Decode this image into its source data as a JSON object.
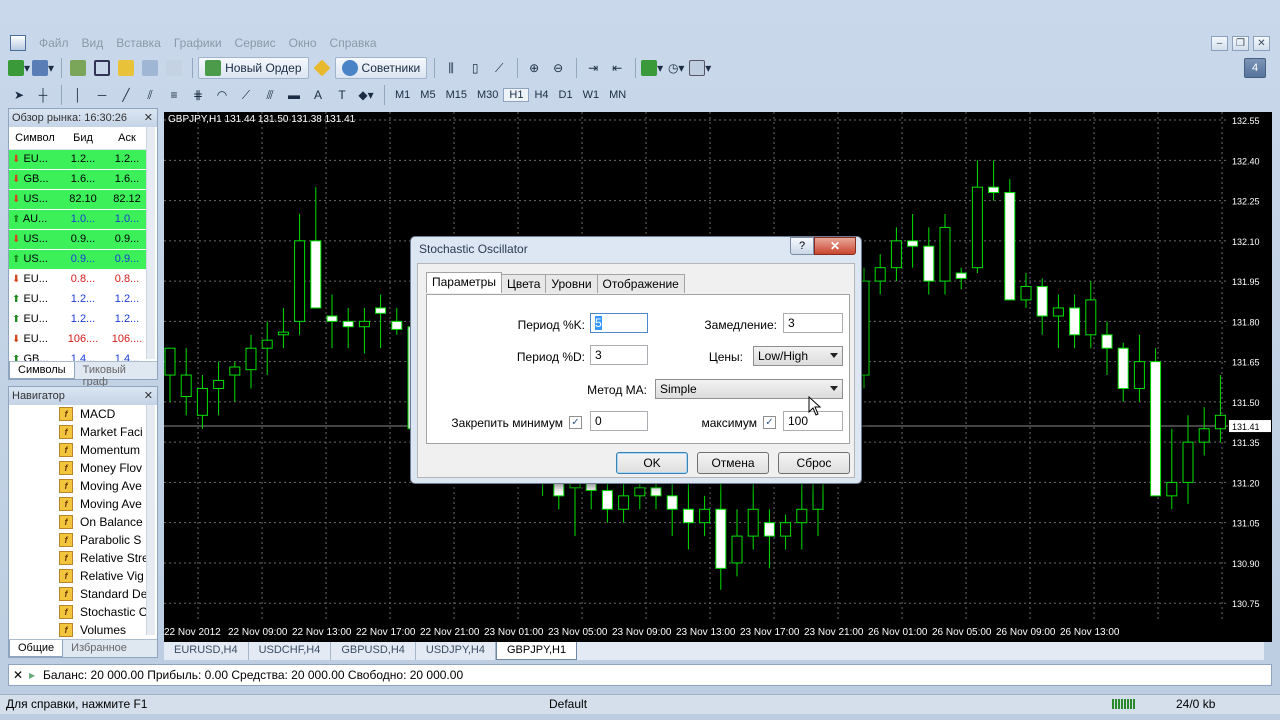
{
  "menu": [
    "Файл",
    "Вид",
    "Вставка",
    "Графики",
    "Сервис",
    "Окно",
    "Справка"
  ],
  "toolbar1": {
    "new_order": "Новый Ордер",
    "experts": "Советники"
  },
  "timeframes": [
    "M1",
    "M5",
    "M15",
    "M30",
    "H1",
    "H4",
    "D1",
    "W1",
    "MN"
  ],
  "notify_count": "4",
  "market_watch": {
    "title": "Обзор рынка: 16:30:26",
    "headers": [
      "Символ",
      "Бид",
      "Аск"
    ],
    "rows": [
      {
        "sym": "EU...",
        "bid": "1.2...",
        "ask": "1.2...",
        "bg": "#3cf05a",
        "dir": "down"
      },
      {
        "sym": "GB...",
        "bid": "1.6...",
        "ask": "1.6...",
        "bg": "#3cf05a",
        "dir": "down"
      },
      {
        "sym": "US...",
        "bid": "82.10",
        "ask": "82.12",
        "bg": "#3cf05a",
        "dir": "down"
      },
      {
        "sym": "AU...",
        "bid": "1.0...",
        "ask": "1.0...",
        "bg": "#3cf05a",
        "dir": "up",
        "color": "#1a3cd6"
      },
      {
        "sym": "US...",
        "bid": "0.9...",
        "ask": "0.9...",
        "bg": "#3cf05a",
        "dir": "down"
      },
      {
        "sym": "US...",
        "bid": "0.9...",
        "ask": "0.9...",
        "bg": "#3cf05a",
        "dir": "up",
        "color": "#1a3cd6"
      },
      {
        "sym": "EU...",
        "bid": "0.8...",
        "ask": "0.8...",
        "bg": "#ffffff",
        "dir": "down",
        "color": "#d41a1a"
      },
      {
        "sym": "EU...",
        "bid": "1.2...",
        "ask": "1.2...",
        "bg": "#ffffff",
        "dir": "up",
        "color": "#1a3cd6"
      },
      {
        "sym": "EU...",
        "bid": "1.2...",
        "ask": "1.2...",
        "bg": "#ffffff",
        "dir": "up",
        "color": "#1a3cd6"
      },
      {
        "sym": "EU...",
        "bid": "106....",
        "ask": "106....",
        "bg": "#ffffff",
        "dir": "down",
        "color": "#d41a1a"
      },
      {
        "sym": "GB...",
        "bid": "1.4...",
        "ask": "1.4...",
        "bg": "#ffffff",
        "dir": "up",
        "color": "#1a3cd6"
      }
    ],
    "tabs": [
      "Символы",
      "Тиковый граф"
    ]
  },
  "navigator": {
    "title": "Навигатор",
    "items": [
      "MACD",
      "Market Faci",
      "Momentum",
      "Money Flov",
      "Moving Ave",
      "Moving Ave",
      "On Balance",
      "Parabolic S",
      "Relative Stre",
      "Relative Vig",
      "Standard De",
      "Stochastic O",
      "Volumes"
    ],
    "tabs": [
      "Общие",
      "Избранное"
    ]
  },
  "chart": {
    "title": "GBPJPY,H1  131.44 131.50 131.38 131.41",
    "price_labels": [
      "132.55",
      "132.40",
      "132.25",
      "132.10",
      "131.95",
      "131.80",
      "131.65",
      "131.50",
      "131.35",
      "131.20",
      "131.05",
      "130.90",
      "130.75"
    ],
    "current_price": "131.41",
    "time_labels": [
      "22 Nov 2012",
      "22 Nov 09:00",
      "22 Nov 13:00",
      "22 Nov 17:00",
      "22 Nov 21:00",
      "23 Nov 01:00",
      "23 Nov 05:00",
      "23 Nov 09:00",
      "23 Nov 13:00",
      "23 Nov 17:00",
      "23 Nov 21:00",
      "26 Nov 01:00",
      "26 Nov 05:00",
      "26 Nov 09:00",
      "26 Nov 13:00"
    ],
    "tabs": [
      "EURUSD,H4",
      "USDCHF,H4",
      "GBPUSD,H4",
      "USDJPY,H4",
      "GBPJPY,H1"
    ]
  },
  "dialog": {
    "title": "Stochastic Oscillator",
    "tabs": [
      "Параметры",
      "Цвета",
      "Уровни",
      "Отображение"
    ],
    "k_label": "Период %K:",
    "k_value": "5",
    "d_label": "Период %D:",
    "d_value": "3",
    "slowing_label": "Замедление:",
    "slowing_value": "3",
    "price_label": "Цены:",
    "price_value": "Low/High",
    "ma_label": "Метод МА:",
    "ma_value": "Simple",
    "fixmin_label": "Закрепить минимум",
    "fixmin_value": "0",
    "max_label": "максимум",
    "max_value": "100",
    "ok": "OK",
    "cancel": "Отмена",
    "reset": "Сброс"
  },
  "terminal": "Баланс: 20 000.00  Прибыль: 0.00  Средства: 20 000.00  Свободно: 20 000.00",
  "status": {
    "help": "Для справки, нажмите F1",
    "profile": "Default",
    "traffic": "24/0 kb"
  }
}
